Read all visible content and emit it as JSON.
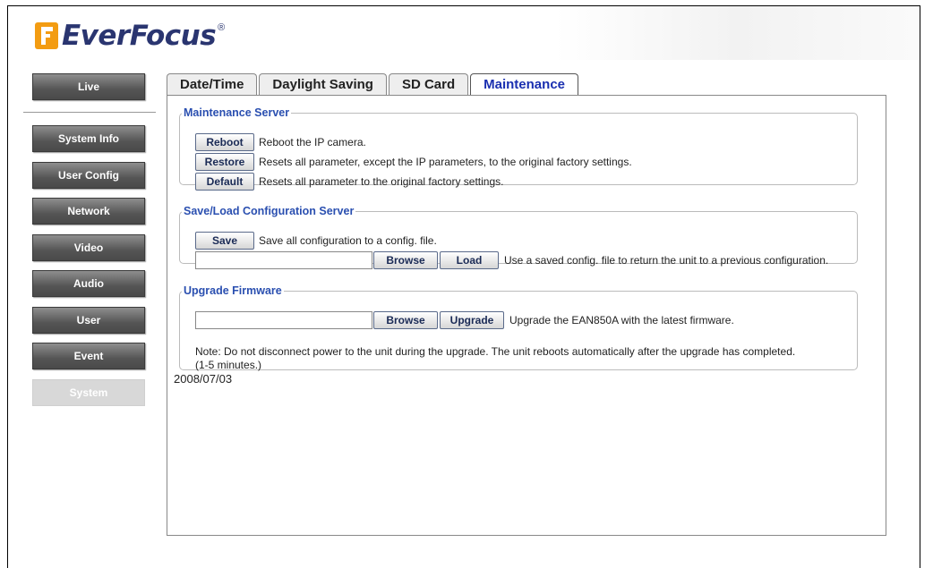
{
  "brand": {
    "name": "EverFocus",
    "registered": "®"
  },
  "nav": {
    "items": [
      {
        "label": "Live"
      },
      {
        "label": "System Info"
      },
      {
        "label": "User Config"
      },
      {
        "label": "Network"
      },
      {
        "label": "Video"
      },
      {
        "label": "Audio"
      },
      {
        "label": "User"
      },
      {
        "label": "Event"
      },
      {
        "label": "System"
      }
    ],
    "active": "System"
  },
  "tabs": [
    {
      "label": "Date/Time"
    },
    {
      "label": "Daylight Saving"
    },
    {
      "label": "SD Card"
    },
    {
      "label": "Maintenance"
    }
  ],
  "active_tab": "Maintenance",
  "maintenance": {
    "legend": "Maintenance Server",
    "reboot": {
      "button": "Reboot",
      "desc": "Reboot the IP camera."
    },
    "restore": {
      "button": "Restore",
      "desc": "Resets all parameter, except the IP parameters, to the original factory settings."
    },
    "default": {
      "button": "Default",
      "desc": "Resets all parameter to the original factory settings."
    }
  },
  "saveload": {
    "legend": "Save/Load Configuration Server",
    "save": {
      "button": "Save",
      "desc": "Save all configuration to a config. file."
    },
    "file_value": "",
    "browse": "Browse",
    "load": "Load",
    "load_desc": "Use a saved config. file to return the unit to a previous configuration."
  },
  "upgrade": {
    "legend": "Upgrade Firmware",
    "file_value": "",
    "browse": "Browse",
    "upgrade": "Upgrade",
    "desc": "Upgrade the EAN850A with the latest firmware.",
    "note_line1": "Note: Do not disconnect power to the unit during the upgrade. The unit reboots automatically after the upgrade has completed.",
    "note_line2": "(1-5 minutes.)"
  },
  "date": "2008/07/03"
}
